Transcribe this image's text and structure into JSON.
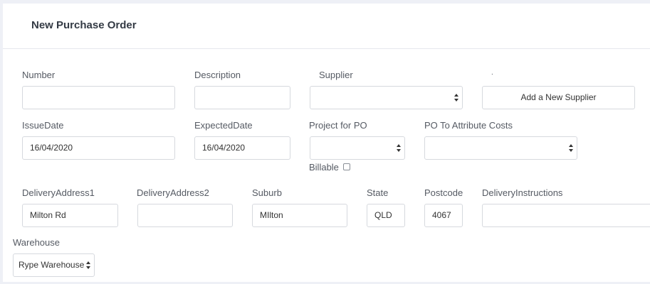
{
  "header": {
    "title": "New Purchase Order"
  },
  "form": {
    "number": {
      "label": "Number",
      "value": ""
    },
    "description": {
      "label": "Description",
      "value": ""
    },
    "supplier": {
      "label": "Supplier",
      "value": ""
    },
    "dot": ".",
    "add_supplier": {
      "label": "Add a New Supplier"
    },
    "issue_date": {
      "label": "IssueDate",
      "value": "16/04/2020"
    },
    "expected_date": {
      "label": "ExpectedDate",
      "value": "16/04/2020"
    },
    "project": {
      "label": "Project for PO",
      "value": ""
    },
    "billable": {
      "label": "Billable",
      "checked": false
    },
    "attribute_costs": {
      "label": "PO To Attribute Costs",
      "value": ""
    },
    "delivery_address1": {
      "label": "DeliveryAddress1",
      "value": "Milton Rd"
    },
    "delivery_address2": {
      "label": "DeliveryAddress2",
      "value": ""
    },
    "suburb": {
      "label": "Suburb",
      "value": "MIlton"
    },
    "state": {
      "label": "State",
      "value": "QLD"
    },
    "postcode": {
      "label": "Postcode",
      "value": "4067"
    },
    "delivery_instructions": {
      "label": "DeliveryInstructions",
      "value": ""
    },
    "warehouse": {
      "label": "Warehouse",
      "value": "Rype Warehouse"
    }
  }
}
